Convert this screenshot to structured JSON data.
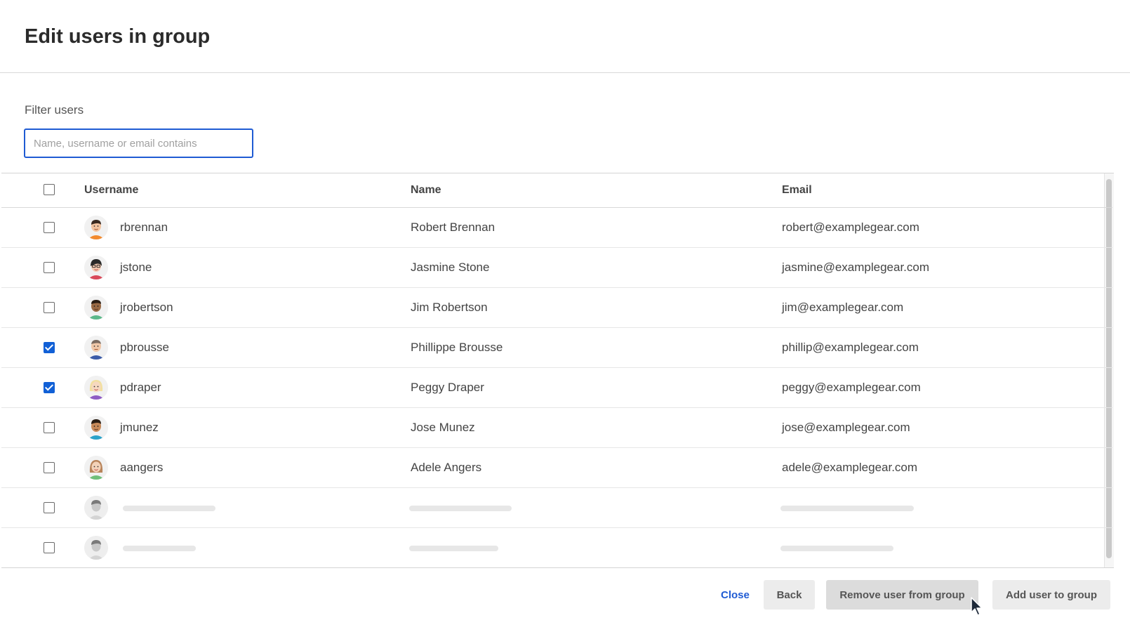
{
  "dialog": {
    "title": "Edit users in group"
  },
  "filter": {
    "label": "Filter users",
    "placeholder": "Name, username or email contains",
    "value": ""
  },
  "table": {
    "headers": {
      "username": "Username",
      "name": "Name",
      "email": "Email"
    },
    "rows": [
      {
        "username": "rbrennan",
        "name": "Robert Brennan",
        "email": "robert@examplegear.com",
        "checked": false,
        "avatar": "male-avatar-orange-shirt"
      },
      {
        "username": "jstone",
        "name": "Jasmine Stone",
        "email": "jasmine@examplegear.com",
        "checked": false,
        "avatar": "female-avatar-glasses"
      },
      {
        "username": "jrobertson",
        "name": "Jim Robertson",
        "email": "jim@examplegear.com",
        "checked": false,
        "avatar": "male-avatar-green-shirt"
      },
      {
        "username": "pbrousse",
        "name": "Phillippe Brousse",
        "email": "phillip@examplegear.com",
        "checked": true,
        "avatar": "male-avatar-blue-shirt"
      },
      {
        "username": "pdraper",
        "name": "Peggy Draper",
        "email": "peggy@examplegear.com",
        "checked": true,
        "avatar": "female-avatar-purple-shirt"
      },
      {
        "username": "jmunez",
        "name": "Jose Munez",
        "email": "jose@examplegear.com",
        "checked": false,
        "avatar": "male-avatar-teal-shirt"
      },
      {
        "username": "aangers",
        "name": "Adele Angers",
        "email": "adele@examplegear.com",
        "checked": false,
        "avatar": "female-avatar-green-shirt"
      }
    ],
    "loading_rows": 2
  },
  "footer": {
    "close_label": "Close",
    "back_label": "Back",
    "remove_label": "Remove user from group",
    "add_label": "Add user to group"
  },
  "colors": {
    "accent": "#1f5bd3",
    "checkbox_checked": "#1160d6"
  }
}
